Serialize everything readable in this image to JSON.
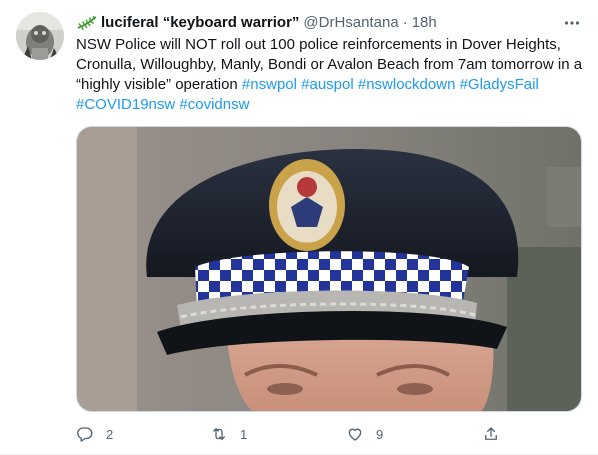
{
  "tweet": {
    "display_name": "luciferal “keyboard warrior”",
    "handle": "@DrHsantana",
    "separator": "·",
    "time": "18h",
    "text_plain": "NSW Police will NOT roll out 100 police reinforcements in Dover Heights, Cronulla, Willoughby, Manly, Bondi or Avalon Beach from 7am tomorrow in a “highly visible” operation",
    "hashtags": [
      "#nswpol",
      "#auspol",
      "#nswlockdown",
      "#GladysFail",
      "#COVID19nsw",
      "#covidnsw"
    ]
  },
  "actions": {
    "reply_count": "2",
    "retweet_count": "1",
    "like_count": "9"
  },
  "colors": {
    "link": "#1d9bf0",
    "muted": "#536471",
    "text": "#0f1419"
  },
  "icons": {
    "name_emoji": "fern-icon",
    "more": "more-icon",
    "reply": "reply-icon",
    "retweet": "retweet-icon",
    "like": "heart-icon",
    "share": "share-icon"
  }
}
